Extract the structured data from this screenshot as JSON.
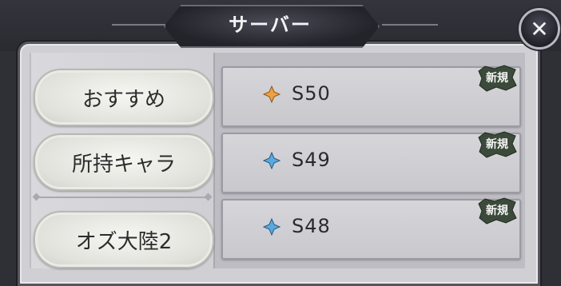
{
  "header": {
    "title": "サーバー"
  },
  "categories": [
    {
      "label": "おすすめ"
    },
    {
      "label": "所持キャラ"
    },
    {
      "label": "オズ大陸2"
    }
  ],
  "servers": [
    {
      "name": "S50",
      "badge": "新規",
      "icon_color": "#f0a040"
    },
    {
      "name": "S49",
      "badge": "新規",
      "icon_color": "#5aa8e0"
    },
    {
      "name": "S48",
      "badge": "新規",
      "icon_color": "#5aa8e0"
    }
  ],
  "colors": {
    "badge_bg": "#3b4a3a",
    "frame": "#cfcfd4"
  }
}
